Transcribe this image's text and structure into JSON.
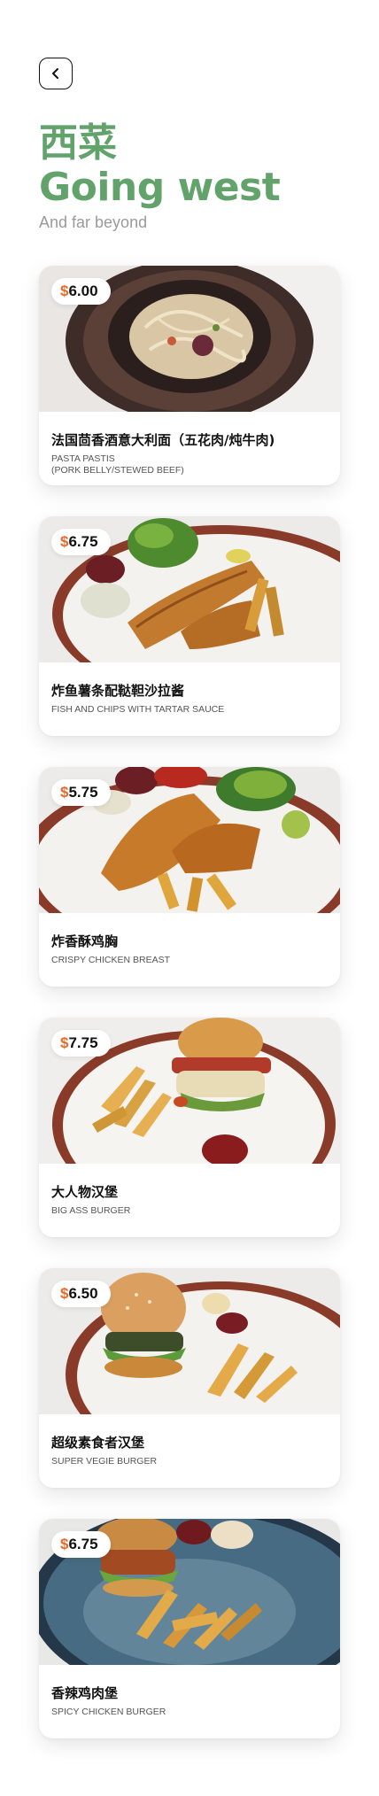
{
  "header": {
    "title_cn": "西菜",
    "title_en": "Going west",
    "subtitle": "And far beyond"
  },
  "currency_symbol": "$",
  "colors": {
    "accent_green": "#62a36c",
    "price_currency": "#e86a2a",
    "subtitle_grey": "#9a9a9a"
  },
  "items": [
    {
      "price": "6.00",
      "name": "法国茴香酒意大利面（五花肉/炖牛肉)",
      "desc": "PASTA PASTIS\n(PORK BELLY/STEWED BEEF)",
      "image": "pasta-dish"
    },
    {
      "price": "6.75",
      "name": "炸鱼薯条配鞑靼沙拉酱",
      "desc": "FISH AND CHIPS WITH TARTAR SAUCE",
      "image": "fish-and-chips"
    },
    {
      "price": "5.75",
      "name": "炸香酥鸡胸",
      "desc": "CRISPY CHICKEN BREAST",
      "image": "chicken-breast"
    },
    {
      "price": "7.75",
      "name": "大人物汉堡",
      "desc": "BIG ASS BURGER",
      "image": "burger"
    },
    {
      "price": "6.50",
      "name": "超级素食者汉堡",
      "desc": "SUPER VEGIE BURGER",
      "image": "vegie-burger"
    },
    {
      "price": "6.75",
      "name": "香辣鸡肉堡",
      "desc": "SPICY CHICKEN BURGER",
      "image": "chicken-burger"
    }
  ]
}
